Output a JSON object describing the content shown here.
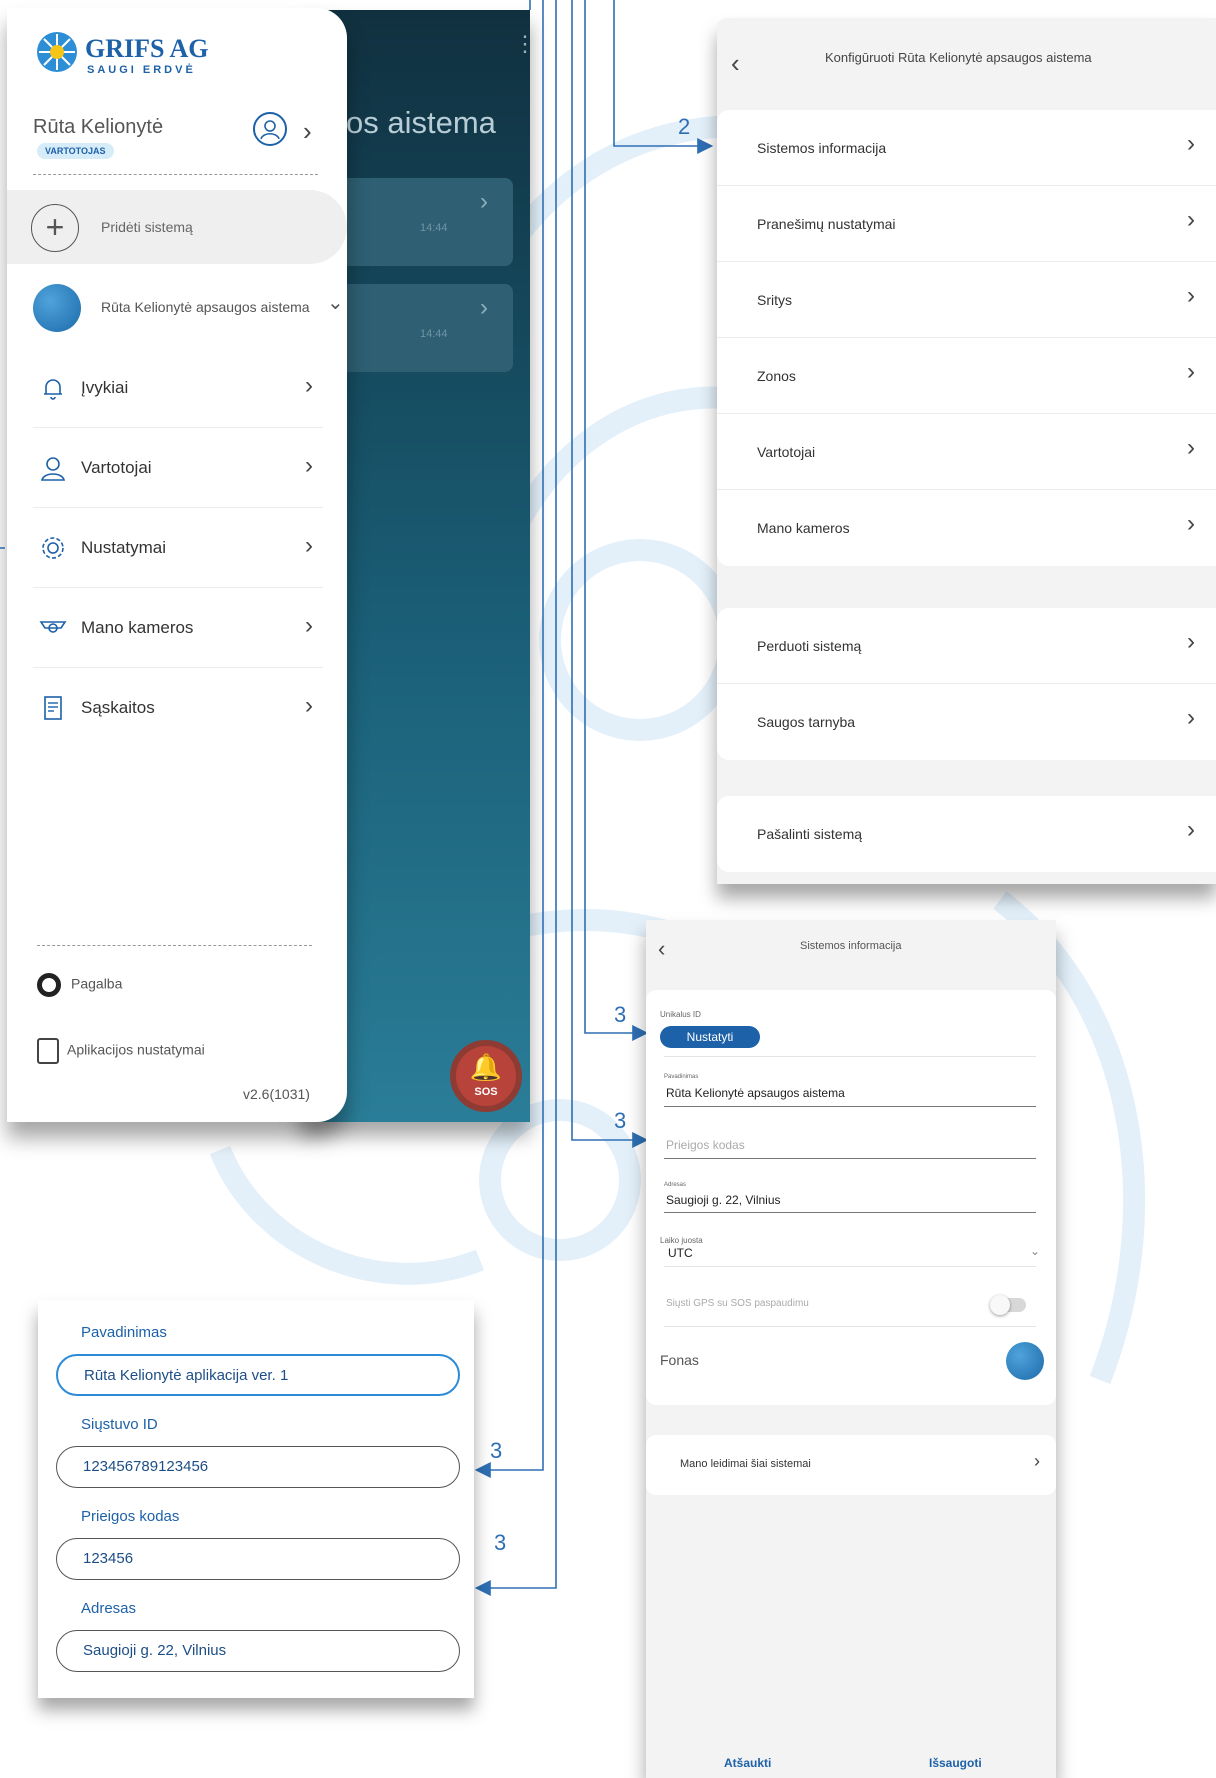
{
  "drawer": {
    "logo_brand": "GRIFS AG",
    "logo_sub": "SAUGI ERDVĖ",
    "user_name": "Rūta Kelionytė",
    "user_role": "VARTOTOJAS",
    "add_system": "Pridėti sistemą",
    "system_name": "Rūta Kelionytė apsaugos aistema",
    "items": [
      {
        "label": "Įvykiai",
        "icon": "bell-icon"
      },
      {
        "label": "Vartotojai",
        "icon": "user-icon"
      },
      {
        "label": "Nustatymai",
        "icon": "gear-icon"
      },
      {
        "label": "Mano kameros",
        "icon": "camera-icon"
      },
      {
        "label": "Sąskaitos",
        "icon": "invoice-icon"
      }
    ],
    "help": "Pagalba",
    "app_settings": "Aplikacijos nustatymai",
    "version": "v2.6(1031)"
  },
  "dark_app": {
    "title_fragment": "os aistema",
    "card_time_1": "14:44",
    "card_time_2": "14:44",
    "sos_label": "SOS"
  },
  "config": {
    "title": "Konfigūruoti Rūta Kelionytė apsaugos aistema",
    "group1": [
      "Sistemos informacija",
      "Pranešimų nustatymai",
      "Sritys",
      "Zonos",
      "Vartotojai",
      "Mano kameros"
    ],
    "group2": [
      "Perduoti sistemą",
      "Saugos tarnyba"
    ],
    "group3": [
      "Pašalinti sistemą"
    ]
  },
  "system_info": {
    "title": "Sistemos informacija",
    "unique_id_label": "Unikalus ID",
    "set_button": "Nustatyti",
    "name_label": "Pavadinimas",
    "name_value": "Rūta Kelionytė apsaugos aistema",
    "access_code_placeholder": "Prieigos kodas",
    "address_label": "Adresas",
    "address_value": "Saugioji g. 22, Vilnius",
    "timezone_label": "Laiko juosta",
    "timezone_value": "UTC",
    "gps_label": "Siųsti GPS su SOS paspaudimu",
    "background_label": "Fonas",
    "permissions": "Mano leidimai šiai sistemai",
    "cancel": "Atšaukti",
    "save": "Išsaugoti"
  },
  "form": {
    "name_label": "Pavadinimas",
    "name_value": "Rūta Kelionytė aplikacija ver. 1",
    "transmitter_label": "Siųstuvo ID",
    "transmitter_value": "123456789123456",
    "access_label": "Prieigos kodas",
    "access_value": "123456",
    "address_label": "Adresas",
    "address_value": "Saugioji g. 22, Vilnius"
  },
  "step_tags": [
    "2",
    "3",
    "3",
    "3",
    "3"
  ],
  "colors": {
    "brand": "#1d61a8",
    "connector": "#2e6fb4"
  }
}
